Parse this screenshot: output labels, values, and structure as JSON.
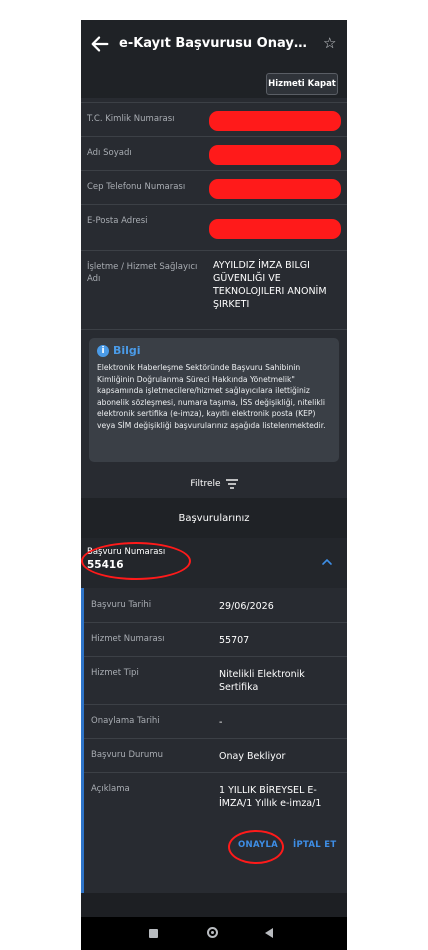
{
  "header": {
    "title": "e-Kayıt Başvurusu Onay İşl...",
    "back_icon": "arrow-left-icon",
    "star_icon": "star-outline-icon"
  },
  "service": {
    "close_label": "Hizmeti Kapat"
  },
  "fields": {
    "tc_label": "T.C. Kimlik Numarası",
    "name_label": "Adı Soyadı",
    "phone_label": "Cep Telefonu Numarası",
    "email_label": "E-Posta Adresi",
    "operator_label": "İşletme / Hizmet Sağlayıcı Adı",
    "operator_value": "AYYILDIZ İMZA BILGI GÜVENLIĞI VE TEKNOLOJILERI ANONİM ŞIRKETI"
  },
  "info": {
    "title": "Bilgi",
    "text": "Elektronik Haberleşme Sektöründe Başvuru Sahibinin Kimliğinin Doğrulanma Süreci Hakkında Yönetmelik\" kapsamında işletmecilere/hizmet sağlayıcılara ilettiğiniz abonelik sözleşmesi, numara taşıma, İSS değişikliği, nitelikli elektronik sertifika (e-imza), kayıtlı elektronik posta (KEP) veya SİM değişikliği başvurularınız aşağıda listelenmektedir."
  },
  "filter": {
    "label": "Filtrele"
  },
  "applications": {
    "header": "Başvurularınız",
    "item": {
      "number_label": "Başvuru Numarası",
      "number_value": "55416",
      "date_label": "Başvuru Tarihi",
      "date_value": "29/06/2026",
      "service_no_label": "Hizmet Numarası",
      "service_no_value": "55707",
      "service_type_label": "Hizmet Tipi",
      "service_type_value": "Nitelikli Elektronik Sertifika",
      "approval_date_label": "Onaylama Tarihi",
      "approval_date_value": "-",
      "status_label": "Başvuru Durumu",
      "status_value": "Onay Bekliyor",
      "desc_label": "Açıklama",
      "desc_value": "1 YILLIK BİREYSEL E-İMZA/1 Yıllık e-imza/1",
      "approve_label": "ONAYLA",
      "cancel_label": "İPTAL ET"
    }
  },
  "colors": {
    "accent": "#3e8ee6",
    "annotation": "#ff1a1a",
    "background": "#282b31"
  }
}
